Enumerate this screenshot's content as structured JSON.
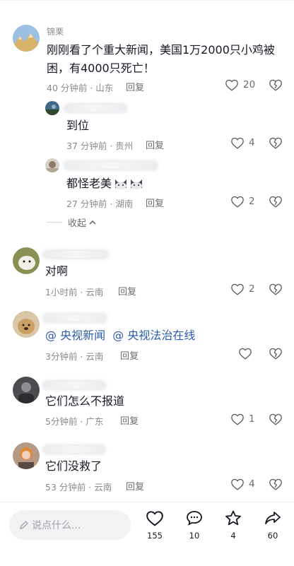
{
  "comments": [
    {
      "username": "锦栗",
      "text": "刚刚看了个重大新闻，美国1万2000只小鸡被困，有4000只死亡！",
      "meta": "40 分钟前 · 山东",
      "reply_label": "回复",
      "likes": "20"
    },
    {
      "text": "到位",
      "meta": "37 分钟前 · 贵州",
      "reply_label": "回复",
      "likes": "4"
    },
    {
      "text": "都怪老美",
      "meta": "27 分钟前 · 湖南",
      "reply_label": "回复",
      "likes": "2"
    },
    {
      "text": "对啊",
      "meta": "1小时前 · 云南",
      "reply_label": "回复",
      "likes": "2"
    },
    {
      "mention1": "@ 央视新闻",
      "mention2": "@ 央视法治在线",
      "meta": "3分钟前 · 云南",
      "reply_label": "回复"
    },
    {
      "text": "它们怎么不报道",
      "meta": "5分钟前 · 广东",
      "reply_label": "回复",
      "likes": "1"
    },
    {
      "text": "它们没救了",
      "meta": "53 分钟前 · 云南",
      "reply_label": "回复",
      "likes": "4"
    }
  ],
  "collapse_label": "收起",
  "input_placeholder": "说点什么...",
  "actions": {
    "likes": "155",
    "comments": "10",
    "favorites": "4",
    "shares": "60"
  },
  "icons": [
    "heart-icon",
    "dislike-heart-icon",
    "chevron-up-icon",
    "pencil-icon",
    "comment-bubble-icon",
    "star-icon",
    "share-arrow-icon"
  ]
}
